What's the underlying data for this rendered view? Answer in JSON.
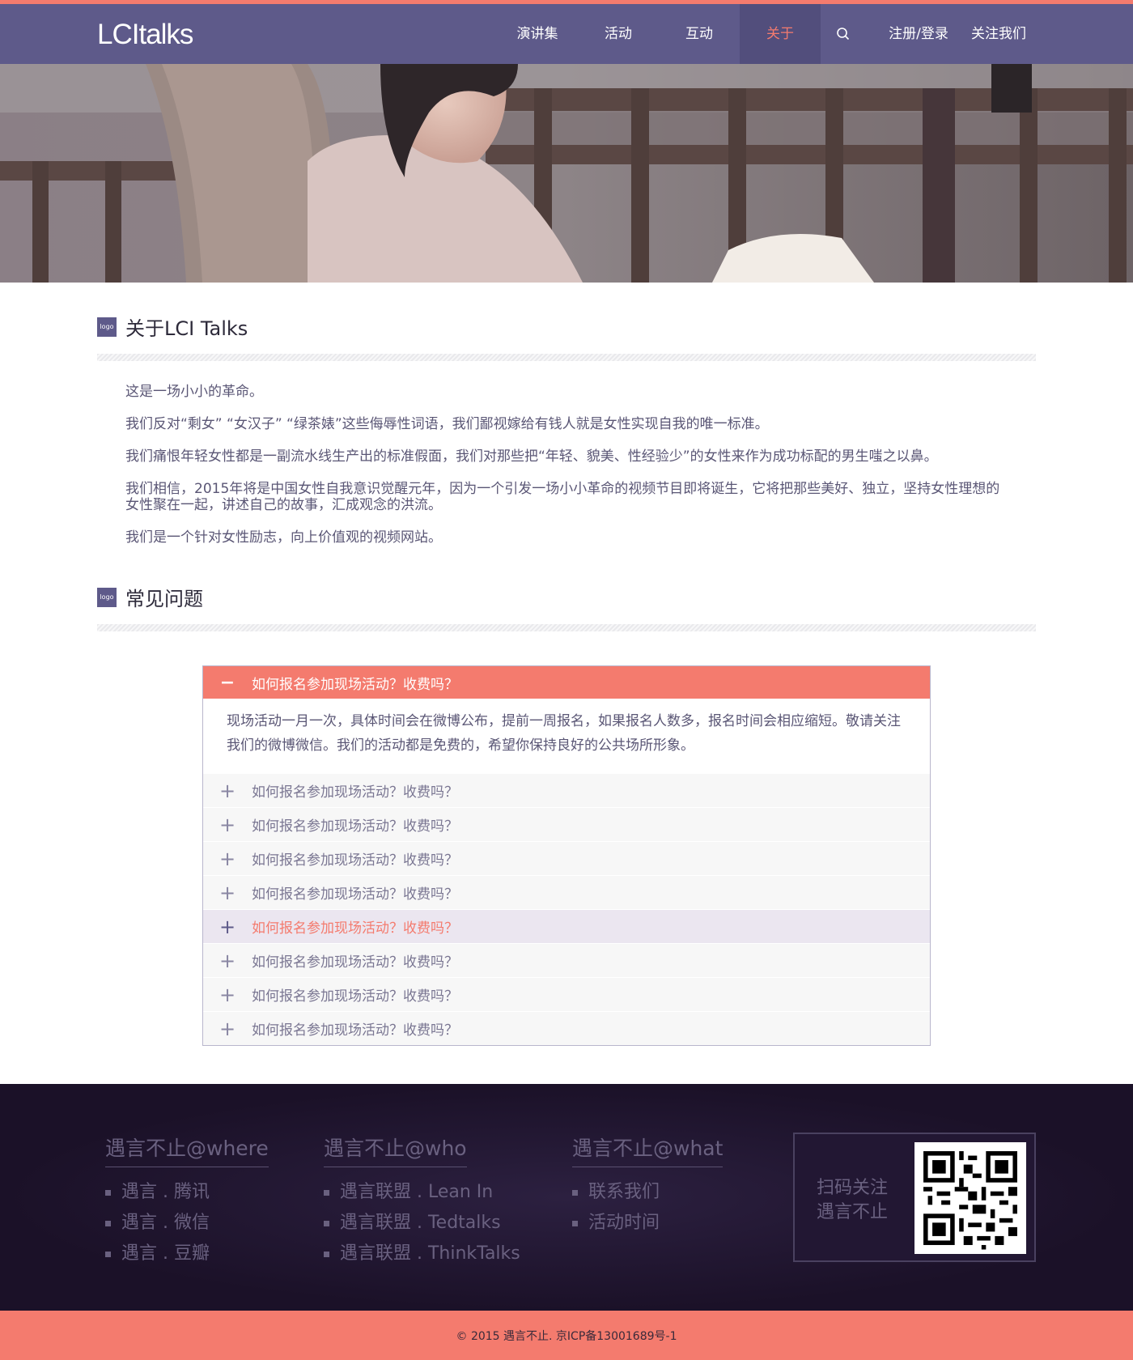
{
  "header": {
    "logo": "LCItalks",
    "nav": [
      {
        "label": "演讲集",
        "active": false
      },
      {
        "label": "活动",
        "active": false
      },
      {
        "label": "互动",
        "active": false
      },
      {
        "label": "关于",
        "active": true
      }
    ],
    "search_icon": "search-icon",
    "nav_right": [
      {
        "label": "注册/登录"
      },
      {
        "label": "关注我们"
      }
    ]
  },
  "about": {
    "badge": "logo",
    "title": "关于LCI Talks",
    "paragraphs": [
      "这是一场小小的革命。",
      "我们反对“剩女” “女汉子” “绿茶婊”这些侮辱性词语，我们鄙视嫁给有钱人就是女性实现自我的唯一标准。",
      "我们痛恨年轻女性都是一副流水线生产出的标准假面，我们对那些把“年轻、貌美、性经验少”的女性来作为成功标配的男生嗤之以鼻。",
      "我们相信，2015年将是中国女性自我意识觉醒元年，因为一个引发一场小小革命的视频节目即将诞生，它将把那些美好、独立，坚持女性理想的女性聚在一起，讲述自己的故事，汇成观念的洪流。",
      "我们是一个针对女性励志，向上价值观的视频网站。"
    ]
  },
  "faq": {
    "badge": "logo",
    "title": "常见问题",
    "open": {
      "question": "如何报名参加现场活动？收费吗？",
      "answer": "现场活动一月一次，具体时间会在微博公布，提前一周报名，如果报名人数多，报名时间会相应缩短。敬请关注我们的微博微信。我们的活动都是免费的，希望你保持良好的公共场所形象。"
    },
    "items": [
      {
        "question": "如何报名参加现场活动？收费吗？",
        "highlight": false
      },
      {
        "question": "如何报名参加现场活动？收费吗？",
        "highlight": false
      },
      {
        "question": "如何报名参加现场活动？收费吗？",
        "highlight": false
      },
      {
        "question": "如何报名参加现场活动？收费吗？",
        "highlight": false
      },
      {
        "question": "如何报名参加现场活动？收费吗？",
        "highlight": true
      },
      {
        "question": "如何报名参加现场活动？收费吗？",
        "highlight": false
      },
      {
        "question": "如何报名参加现场活动？收费吗？",
        "highlight": false
      },
      {
        "question": "如何报名参加现场活动？收费吗？",
        "highlight": false
      }
    ]
  },
  "footer": {
    "columns": [
      {
        "title": "遇言不止@where",
        "items": [
          "遇言 . 腾讯",
          "遇言 . 微信",
          "遇言 . 豆瓣"
        ]
      },
      {
        "title": "遇言不止@who",
        "items": [
          "遇言联盟 . Lean In",
          "遇言联盟 . Tedtalks",
          "遇言联盟 . ThinkTalks"
        ]
      },
      {
        "title": "遇言不止@what",
        "items": [
          "联系我们",
          "活动时间"
        ]
      }
    ],
    "qr_text_line1": "扫码关注",
    "qr_text_line2": "遇言不止",
    "copyright": "© 2015 遇言不止. 京ICP备13001689号-1"
  },
  "colors": {
    "accent": "#f47b6e",
    "header": "#5e5a8a",
    "footer": "#1b1128"
  }
}
